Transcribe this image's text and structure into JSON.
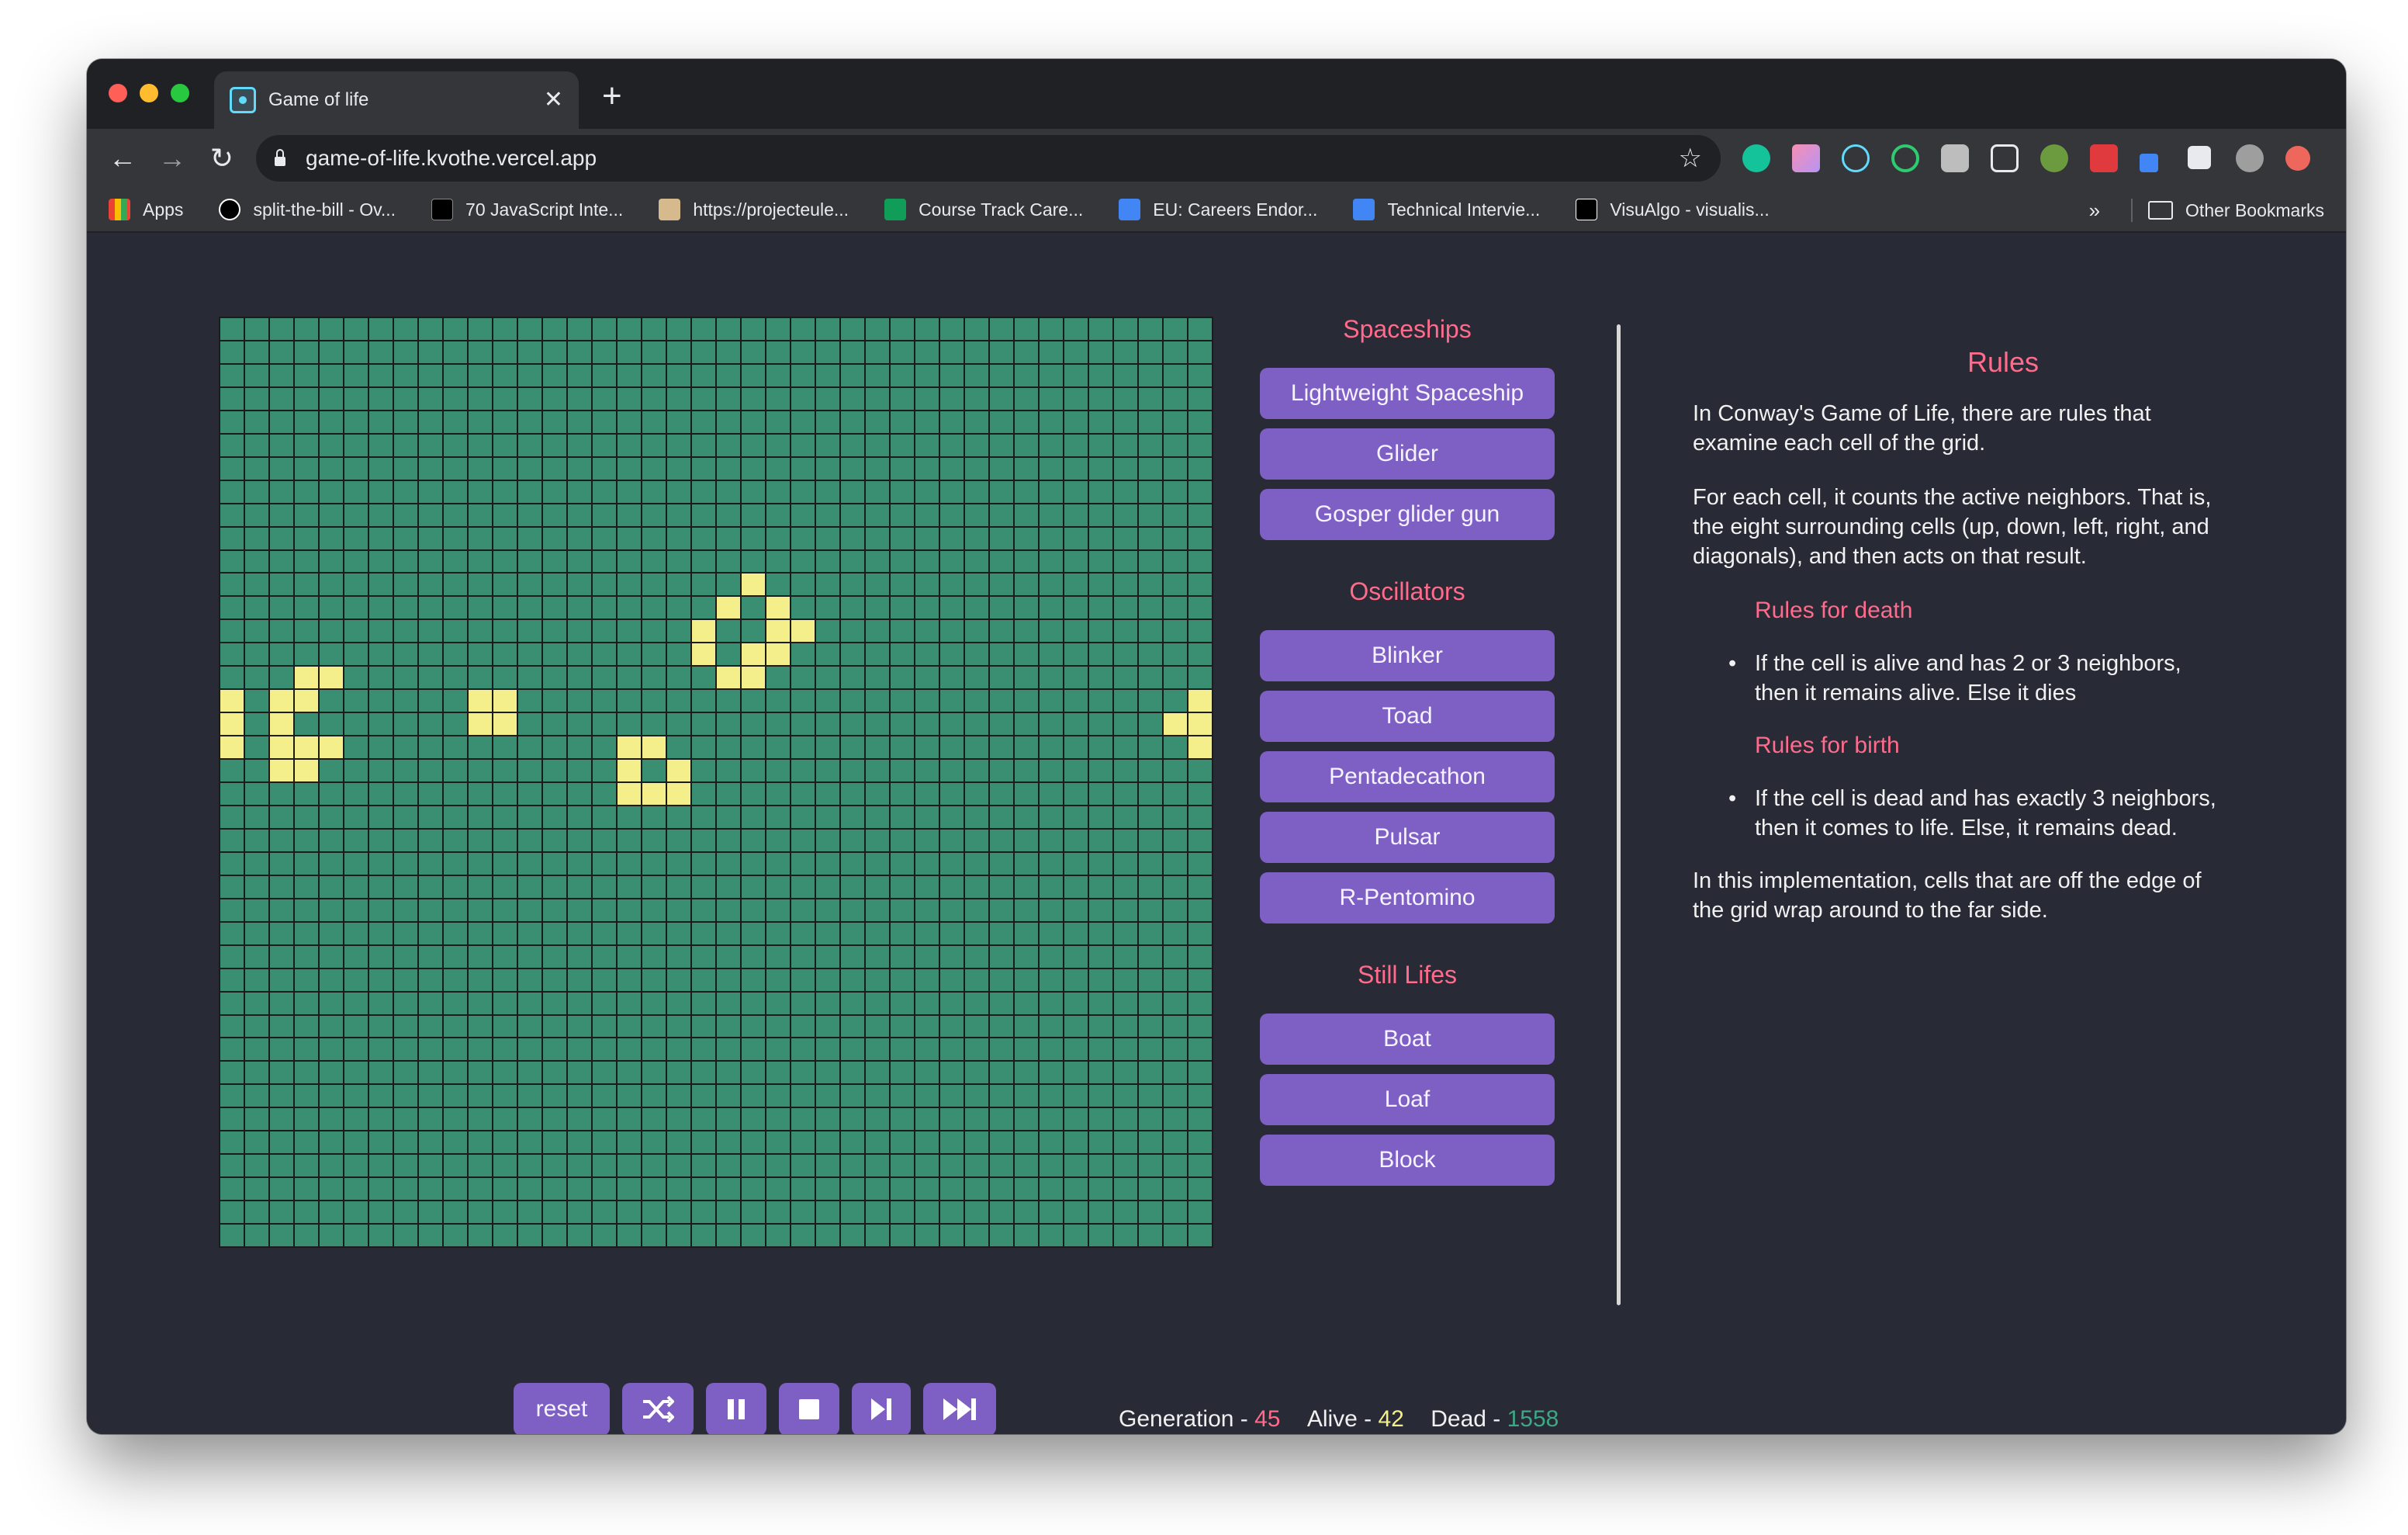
{
  "browser": {
    "tab_title": "Game of life",
    "url": "game-of-life.kvothe.vercel.app",
    "bookmarks": [
      {
        "label": "Apps",
        "icon": "apps-grid-icon",
        "color": "#ea4335"
      },
      {
        "label": "split-the-bill - Ov...",
        "icon": "triangle-logo-icon",
        "color": "#ffffff"
      },
      {
        "label": "70 JavaScript Inte...",
        "icon": "dev-logo-icon",
        "color": "#000000"
      },
      {
        "label": "https://projecteule...",
        "icon": "page-icon",
        "color": "#d7b98e"
      },
      {
        "label": "Course Track Care...",
        "icon": "sheet-icon",
        "color": "#0f9d58"
      },
      {
        "label": "EU: Careers Endor...",
        "icon": "doc-icon",
        "color": "#4285f4"
      },
      {
        "label": "Technical Intervie...",
        "icon": "doc-icon",
        "color": "#4285f4"
      },
      {
        "label": "VisuAlgo - visualis...",
        "icon": "visualgo-icon",
        "color": "#000000"
      }
    ],
    "other_bookmarks": "Other Bookmarks",
    "overflow": "»"
  },
  "panel": {
    "spaceships_title": "Spaceships",
    "spaceships": [
      "Lightweight Spaceship",
      "Glider",
      "Gosper glider gun"
    ],
    "oscillators_title": "Oscillators",
    "oscillators": [
      "Blinker",
      "Toad",
      "Pentadecathon",
      "Pulsar",
      "R-Pentomino"
    ],
    "still_title": "Still Lifes",
    "still": [
      "Boat",
      "Loaf",
      "Block"
    ]
  },
  "rules": {
    "title": "Rules",
    "p1": "In Conway's Game of Life, there are rules that examine each cell of the grid.",
    "p2": "For each cell, it counts the active neighbors. That is, the eight surrounding cells (up, down, left, right, and diagonals), and then acts on that result.",
    "death_title": "Rules for death",
    "death_rule": "If the cell is alive and has 2 or 3 neighbors, then it remains alive. Else it dies",
    "birth_title": "Rules for birth",
    "birth_rule": "If the cell is dead and has exactly 3 neighbors, then it comes to life. Else, it remains dead.",
    "p3": "In this implementation, cells that are off the edge of the grid wrap around to the far side."
  },
  "controls": {
    "reset": "reset",
    "shuffle_icon": "shuffle-icon",
    "pause_icon": "pause-icon",
    "stop_icon": "stop-icon",
    "step_icon": "step-forward-icon",
    "fast_icon": "fast-forward-icon"
  },
  "stats": {
    "generation_label": "Generation - ",
    "generation": "45",
    "alive_label": "Alive - ",
    "alive": "42",
    "dead_label": "Dead - ",
    "dead": "1558"
  },
  "grid": {
    "cols": 40,
    "rows": 40,
    "alive_cells": [
      [
        11,
        21
      ],
      [
        12,
        20
      ],
      [
        12,
        22
      ],
      [
        13,
        19
      ],
      [
        13,
        22
      ],
      [
        13,
        23
      ],
      [
        14,
        19
      ],
      [
        14,
        21
      ],
      [
        14,
        22
      ],
      [
        15,
        20
      ],
      [
        15,
        21
      ],
      [
        15,
        3
      ],
      [
        15,
        4
      ],
      [
        16,
        0
      ],
      [
        16,
        2
      ],
      [
        16,
        3
      ],
      [
        16,
        10
      ],
      [
        16,
        11
      ],
      [
        16,
        39
      ],
      [
        17,
        0
      ],
      [
        17,
        2
      ],
      [
        17,
        10
      ],
      [
        17,
        11
      ],
      [
        17,
        38
      ],
      [
        17,
        39
      ],
      [
        18,
        0
      ],
      [
        18,
        2
      ],
      [
        18,
        3
      ],
      [
        18,
        4
      ],
      [
        18,
        16
      ],
      [
        18,
        17
      ],
      [
        18,
        39
      ],
      [
        19,
        2
      ],
      [
        19,
        3
      ],
      [
        19,
        16
      ],
      [
        19,
        18
      ],
      [
        20,
        16
      ],
      [
        20,
        17
      ],
      [
        20,
        18
      ]
    ]
  },
  "colors": {
    "dead_cell": "#3a8f73",
    "alive_cell": "#f4ef8b",
    "accent": "#7e5fc4",
    "pink": "#ff6b8b",
    "page_bg": "#282a36"
  }
}
